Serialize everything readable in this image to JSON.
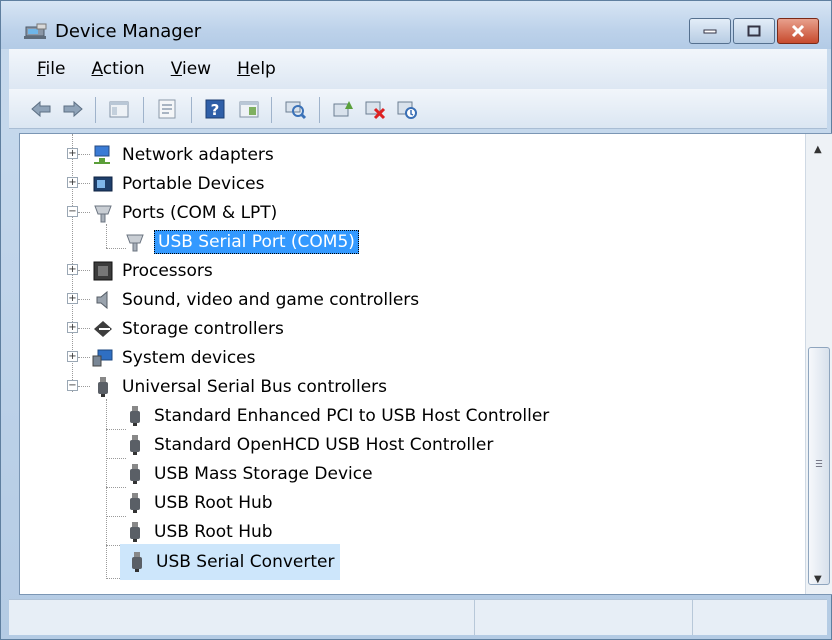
{
  "window": {
    "title": "Device Manager",
    "icons": [
      "device-manager-icon",
      "minimize-icon",
      "maximize-icon",
      "close-icon"
    ]
  },
  "menu": {
    "items": [
      "File",
      "Action",
      "View",
      "Help"
    ]
  },
  "toolbar": {
    "icons": [
      "back-icon",
      "forward-icon",
      "show-hide-tree-icon",
      "properties-icon",
      "help-icon",
      "action-pane-icon",
      "scan-hardware-icon",
      "update-driver-icon",
      "uninstall-icon",
      "disable-icon"
    ]
  },
  "tree": {
    "items": [
      {
        "label": "Network adapters",
        "icon": "network-adapter-icon",
        "expanded": false
      },
      {
        "label": "Portable Devices",
        "icon": "portable-device-icon",
        "expanded": false
      },
      {
        "label": "Ports (COM & LPT)",
        "icon": "port-icon",
        "expanded": true
      },
      {
        "label": "USB Serial Port (COM5)",
        "icon": "port-icon",
        "selected": true
      },
      {
        "label": "Processors",
        "icon": "processor-icon",
        "expanded": false
      },
      {
        "label": "Sound, video and game controllers",
        "icon": "speaker-icon",
        "expanded": false
      },
      {
        "label": "Storage controllers",
        "icon": "storage-icon",
        "expanded": false
      },
      {
        "label": "System devices",
        "icon": "system-device-icon",
        "expanded": false
      },
      {
        "label": "Universal Serial Bus controllers",
        "icon": "usb-icon",
        "expanded": true
      },
      {
        "label": "Standard Enhanced PCI to USB Host Controller",
        "icon": "usb-icon"
      },
      {
        "label": "Standard OpenHCD USB Host Controller",
        "icon": "usb-icon"
      },
      {
        "label": "USB Mass Storage Device",
        "icon": "usb-icon"
      },
      {
        "label": "USB Root Hub",
        "icon": "usb-icon"
      },
      {
        "label": "USB Root Hub",
        "icon": "usb-icon"
      },
      {
        "label": "USB Serial Converter",
        "icon": "usb-icon",
        "highlighted": true
      }
    ]
  },
  "colors": {
    "selection": "#3399ff",
    "hover_highlight": "#cde6fb"
  }
}
